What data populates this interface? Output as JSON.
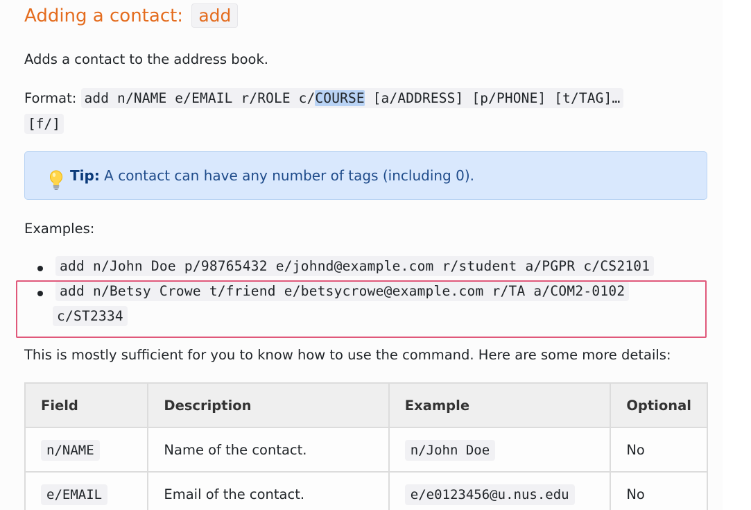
{
  "heading": {
    "text": "Adding a contact: ",
    "command": "add"
  },
  "intro": "Adds a contact to the address book.",
  "format": {
    "label": "Format: ",
    "code_before": "add n/NAME e/EMAIL r/ROLE c/",
    "code_highlight": "COURSE",
    "code_after": " [a/ADDRESS] [p/PHONE] [t/TAG]…",
    "code_line2": "[f/]"
  },
  "tip": {
    "icon": "lightbulb-icon",
    "label": "Tip:",
    "text": " A contact can have any number of tags (including 0)."
  },
  "examples": {
    "label": "Examples:",
    "items": [
      {
        "line1": "add n/John Doe p/98765432 e/johnd@example.com r/student a/PGPR c/CS2101"
      },
      {
        "line1": "add n/Betsy Crowe t/friend e/betsycrowe@example.com r/TA a/COM2-0102",
        "line2": "c/ST2334"
      }
    ]
  },
  "sufficient": "This is mostly sufficient for you to know how to use the command. Here are some more details:",
  "table": {
    "headers": [
      "Field",
      "Description",
      "Example",
      "Optional"
    ],
    "rows": [
      {
        "field": "n/NAME",
        "description": "Name of the contact.",
        "example": "n/John Doe",
        "optional": "No"
      },
      {
        "field": "e/EMAIL",
        "description": "Email of the contact.",
        "example": "e/e0123456@u.nus.edu",
        "optional": "No"
      }
    ]
  },
  "colors": {
    "heading": "#e46c1e",
    "tip_bg": "#d9e8fd",
    "tip_text": "#1e4b8a",
    "highlight_box": "#e0587a",
    "selection": "#b9d3f5"
  }
}
